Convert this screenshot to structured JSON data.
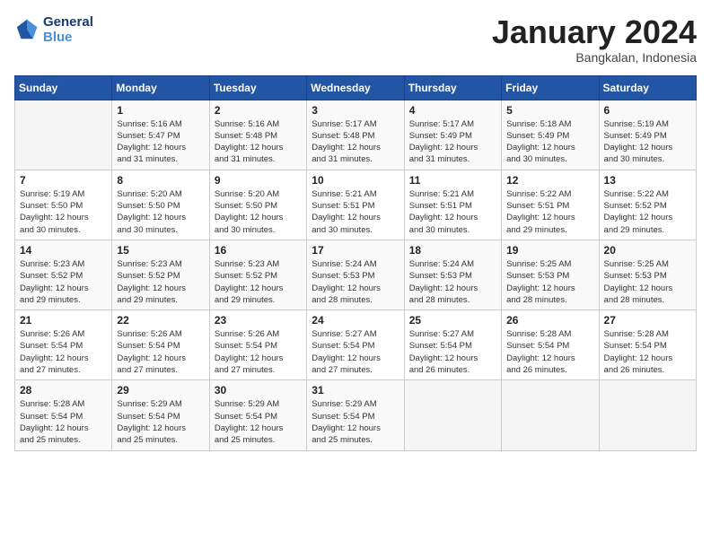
{
  "header": {
    "logo_line1": "General",
    "logo_line2": "Blue",
    "month": "January 2024",
    "location": "Bangkalan, Indonesia"
  },
  "weekdays": [
    "Sunday",
    "Monday",
    "Tuesday",
    "Wednesday",
    "Thursday",
    "Friday",
    "Saturday"
  ],
  "weeks": [
    [
      {
        "day": "",
        "info": ""
      },
      {
        "day": "1",
        "info": "Sunrise: 5:16 AM\nSunset: 5:47 PM\nDaylight: 12 hours\nand 31 minutes."
      },
      {
        "day": "2",
        "info": "Sunrise: 5:16 AM\nSunset: 5:48 PM\nDaylight: 12 hours\nand 31 minutes."
      },
      {
        "day": "3",
        "info": "Sunrise: 5:17 AM\nSunset: 5:48 PM\nDaylight: 12 hours\nand 31 minutes."
      },
      {
        "day": "4",
        "info": "Sunrise: 5:17 AM\nSunset: 5:49 PM\nDaylight: 12 hours\nand 31 minutes."
      },
      {
        "day": "5",
        "info": "Sunrise: 5:18 AM\nSunset: 5:49 PM\nDaylight: 12 hours\nand 30 minutes."
      },
      {
        "day": "6",
        "info": "Sunrise: 5:19 AM\nSunset: 5:49 PM\nDaylight: 12 hours\nand 30 minutes."
      }
    ],
    [
      {
        "day": "7",
        "info": "Sunrise: 5:19 AM\nSunset: 5:50 PM\nDaylight: 12 hours\nand 30 minutes."
      },
      {
        "day": "8",
        "info": "Sunrise: 5:20 AM\nSunset: 5:50 PM\nDaylight: 12 hours\nand 30 minutes."
      },
      {
        "day": "9",
        "info": "Sunrise: 5:20 AM\nSunset: 5:50 PM\nDaylight: 12 hours\nand 30 minutes."
      },
      {
        "day": "10",
        "info": "Sunrise: 5:21 AM\nSunset: 5:51 PM\nDaylight: 12 hours\nand 30 minutes."
      },
      {
        "day": "11",
        "info": "Sunrise: 5:21 AM\nSunset: 5:51 PM\nDaylight: 12 hours\nand 30 minutes."
      },
      {
        "day": "12",
        "info": "Sunrise: 5:22 AM\nSunset: 5:51 PM\nDaylight: 12 hours\nand 29 minutes."
      },
      {
        "day": "13",
        "info": "Sunrise: 5:22 AM\nSunset: 5:52 PM\nDaylight: 12 hours\nand 29 minutes."
      }
    ],
    [
      {
        "day": "14",
        "info": "Sunrise: 5:23 AM\nSunset: 5:52 PM\nDaylight: 12 hours\nand 29 minutes."
      },
      {
        "day": "15",
        "info": "Sunrise: 5:23 AM\nSunset: 5:52 PM\nDaylight: 12 hours\nand 29 minutes."
      },
      {
        "day": "16",
        "info": "Sunrise: 5:23 AM\nSunset: 5:52 PM\nDaylight: 12 hours\nand 29 minutes."
      },
      {
        "day": "17",
        "info": "Sunrise: 5:24 AM\nSunset: 5:53 PM\nDaylight: 12 hours\nand 28 minutes."
      },
      {
        "day": "18",
        "info": "Sunrise: 5:24 AM\nSunset: 5:53 PM\nDaylight: 12 hours\nand 28 minutes."
      },
      {
        "day": "19",
        "info": "Sunrise: 5:25 AM\nSunset: 5:53 PM\nDaylight: 12 hours\nand 28 minutes."
      },
      {
        "day": "20",
        "info": "Sunrise: 5:25 AM\nSunset: 5:53 PM\nDaylight: 12 hours\nand 28 minutes."
      }
    ],
    [
      {
        "day": "21",
        "info": "Sunrise: 5:26 AM\nSunset: 5:54 PM\nDaylight: 12 hours\nand 27 minutes."
      },
      {
        "day": "22",
        "info": "Sunrise: 5:26 AM\nSunset: 5:54 PM\nDaylight: 12 hours\nand 27 minutes."
      },
      {
        "day": "23",
        "info": "Sunrise: 5:26 AM\nSunset: 5:54 PM\nDaylight: 12 hours\nand 27 minutes."
      },
      {
        "day": "24",
        "info": "Sunrise: 5:27 AM\nSunset: 5:54 PM\nDaylight: 12 hours\nand 27 minutes."
      },
      {
        "day": "25",
        "info": "Sunrise: 5:27 AM\nSunset: 5:54 PM\nDaylight: 12 hours\nand 26 minutes."
      },
      {
        "day": "26",
        "info": "Sunrise: 5:28 AM\nSunset: 5:54 PM\nDaylight: 12 hours\nand 26 minutes."
      },
      {
        "day": "27",
        "info": "Sunrise: 5:28 AM\nSunset: 5:54 PM\nDaylight: 12 hours\nand 26 minutes."
      }
    ],
    [
      {
        "day": "28",
        "info": "Sunrise: 5:28 AM\nSunset: 5:54 PM\nDaylight: 12 hours\nand 25 minutes."
      },
      {
        "day": "29",
        "info": "Sunrise: 5:29 AM\nSunset: 5:54 PM\nDaylight: 12 hours\nand 25 minutes."
      },
      {
        "day": "30",
        "info": "Sunrise: 5:29 AM\nSunset: 5:54 PM\nDaylight: 12 hours\nand 25 minutes."
      },
      {
        "day": "31",
        "info": "Sunrise: 5:29 AM\nSunset: 5:54 PM\nDaylight: 12 hours\nand 25 minutes."
      },
      {
        "day": "",
        "info": ""
      },
      {
        "day": "",
        "info": ""
      },
      {
        "day": "",
        "info": ""
      }
    ]
  ]
}
